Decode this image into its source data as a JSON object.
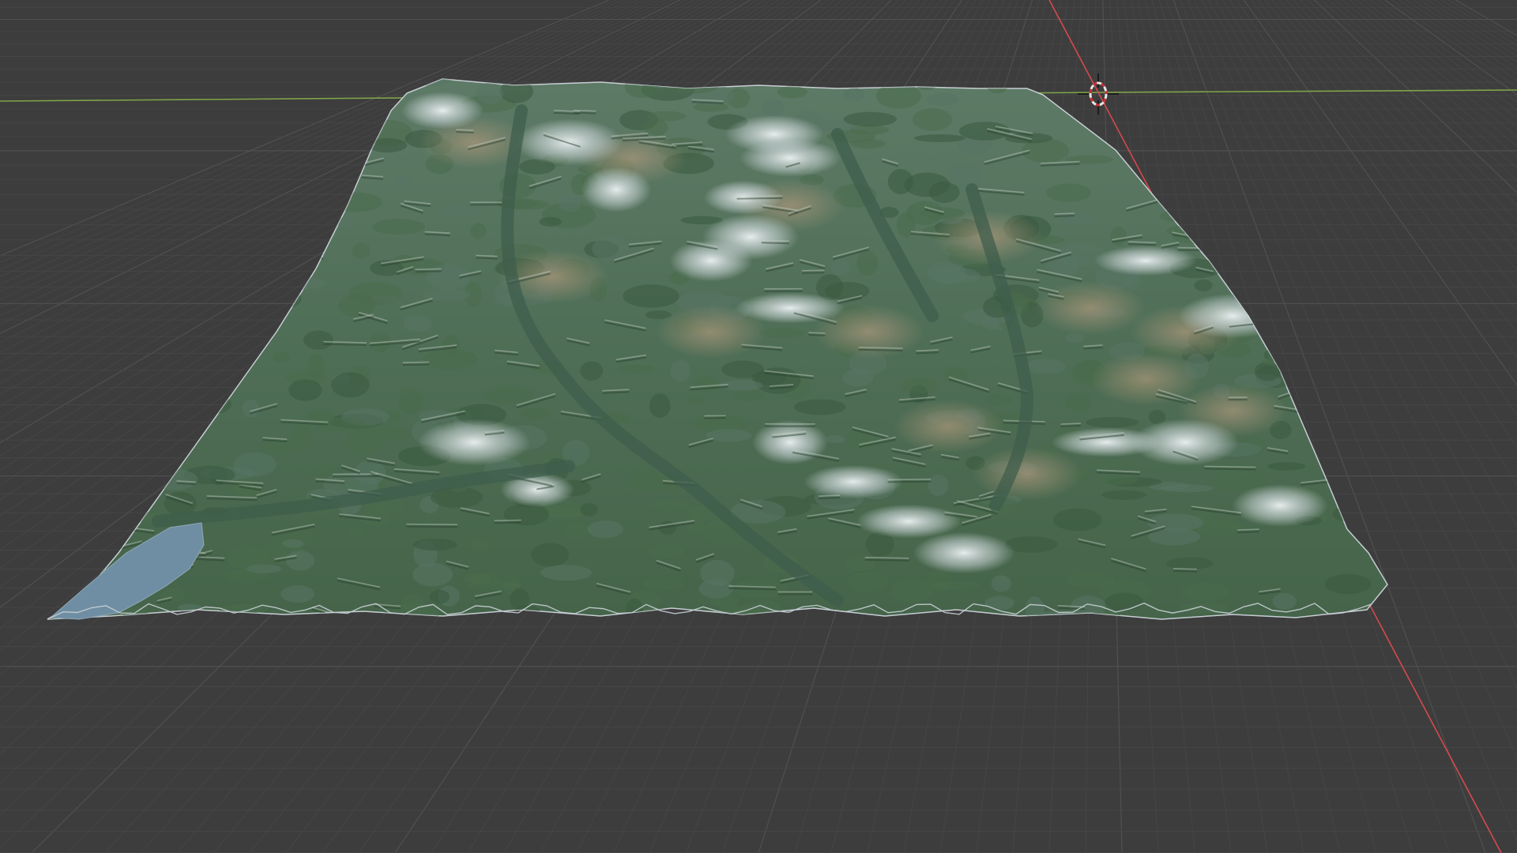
{
  "viewport": {
    "background": "#3d3d3d",
    "grid_minor_color": "#474747",
    "grid_major_color": "#505050",
    "x_axis_color": "#d9484d",
    "y_axis_color": "#7fa34a"
  },
  "terrain": {
    "lake_color": "#6f8ea3",
    "forest_color": "#4a6b4c",
    "valley_color": "#587564",
    "rock_color": "#9a8a6c",
    "snow_color": "#d9e2e6",
    "edge_color": "#c7ced4"
  },
  "cursor": {
    "icon": "3d-cursor-icon",
    "ring_color": "#e6e6e6",
    "ring_accent_color": "#c8303a"
  }
}
